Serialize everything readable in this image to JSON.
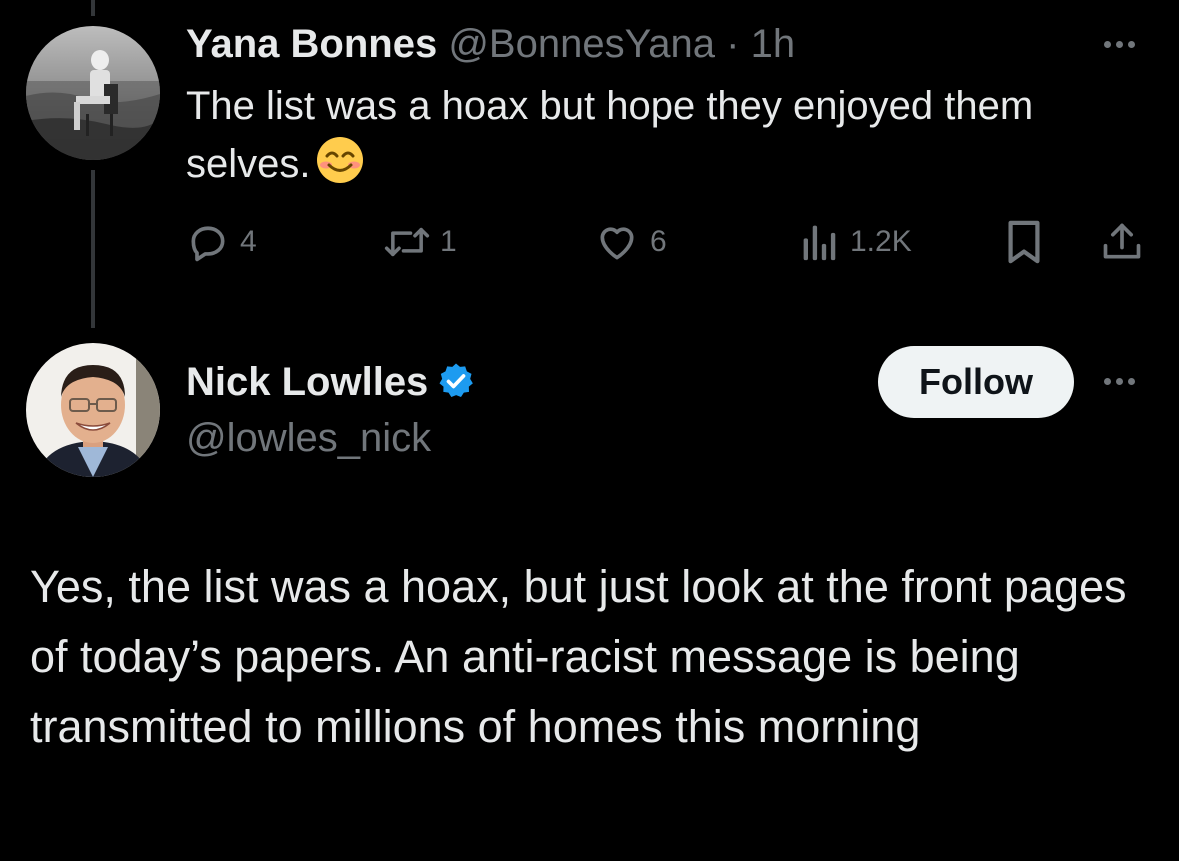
{
  "tweet1": {
    "display_name": "Yana Bonnes",
    "handle": "@BonnesYana",
    "separator": "·",
    "time": "1h",
    "text": "The list was a hoax but hope they enjoyed them selves.",
    "emoji_icon": "smiling-face-icon",
    "actions": {
      "replies": "4",
      "reposts": "1",
      "likes": "6",
      "views": "1.2K"
    }
  },
  "tweet2": {
    "display_name": "Nick Lowlles",
    "handle": "@lowles_nick",
    "verified_icon": "verified-badge-icon",
    "follow_label": "Follow",
    "text": "Yes, the list was a hoax, but just look at the front pages of today’s papers. An anti-racist message is being transmitted to millions of homes this morning"
  },
  "colors": {
    "background": "#000000",
    "primary_text": "#e7e9ea",
    "secondary_text": "#71767b",
    "verified_blue": "#1d9bf0",
    "follow_button_bg": "#eff3f4"
  }
}
